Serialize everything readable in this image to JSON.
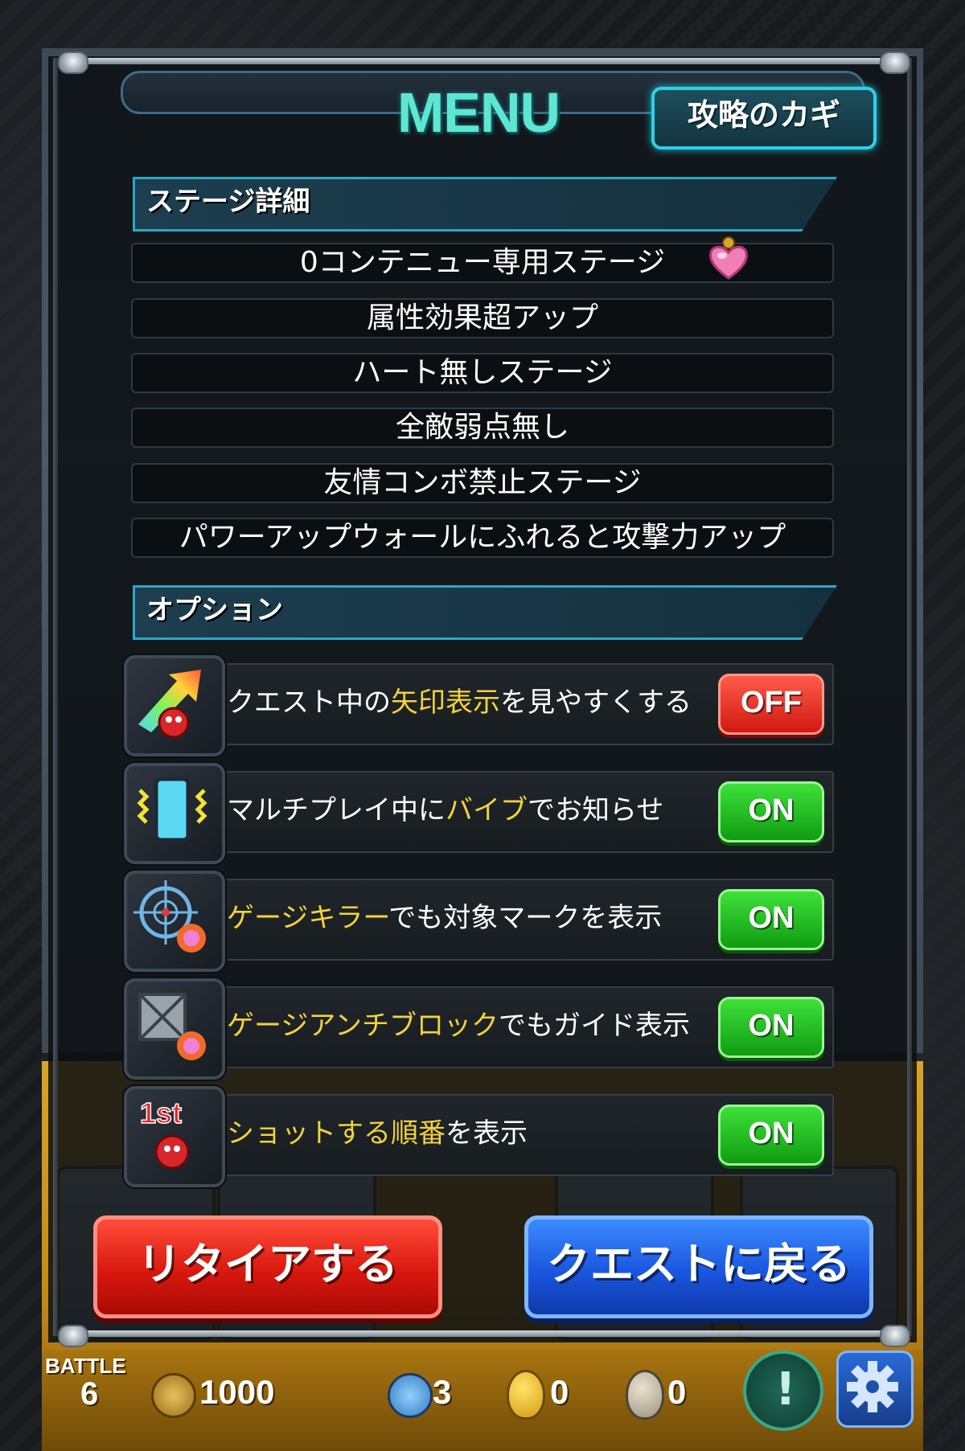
{
  "header": {
    "title": "MENU",
    "hint_button": "攻略のカギ"
  },
  "stage_details": {
    "section_label": "ステージ詳細",
    "items": [
      "0コンテニュー専用ステージ",
      "属性効果超アップ",
      "ハート無しステージ",
      "全敵弱点無し",
      "友情コンボ禁止ステージ",
      "パワーアップウォールにふれると攻撃力アップ"
    ]
  },
  "options": {
    "section_label": "オプション",
    "items": [
      {
        "icon": "arrow-display-icon",
        "text_pre": "クエスト中の",
        "text_hl": "矢印表示",
        "text_post": "を見やすくする",
        "toggle": "OFF"
      },
      {
        "icon": "vibrate-phone-icon",
        "text_pre": "マルチプレイ中に",
        "text_hl": "バイブ",
        "text_post": "でお知らせ",
        "toggle": "ON"
      },
      {
        "icon": "target-mark-icon",
        "text_pre": "",
        "text_hl": "ゲージキラー",
        "text_post": "でも対象マークを表示",
        "toggle": "ON"
      },
      {
        "icon": "block-guide-icon",
        "text_pre": "",
        "text_hl": "ゲージアンチブロック",
        "text_post": "でもガイド表示",
        "toggle": "ON"
      },
      {
        "icon": "shot-order-icon",
        "text_pre": "",
        "text_hl": "ショットする順番",
        "text_post": "を表示",
        "toggle": "ON"
      }
    ],
    "shot_order_badge": "1st"
  },
  "buttons": {
    "retire": "リタイアする",
    "back_to_quest": "クエストに戻る"
  },
  "status": {
    "battle_label": "BATTLE",
    "battle_value": "6",
    "gold": "1000",
    "items_a": "3",
    "items_b": "0",
    "items_c": "0"
  },
  "colors": {
    "accent_cyan": "#5fe6d2",
    "highlight_yellow": "#f4d23a",
    "toggle_on": "#1fb51c",
    "toggle_off": "#e0241a",
    "retire_red": "#d9180f",
    "back_blue": "#1a56e0"
  }
}
